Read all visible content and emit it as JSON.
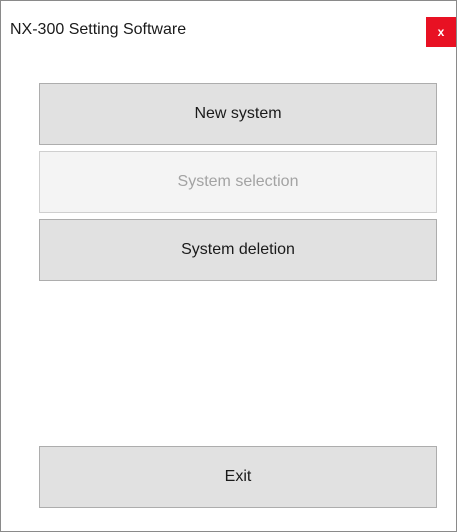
{
  "window": {
    "title": "NX-300 Setting Software",
    "close_glyph": "x",
    "close_icon": "close-icon",
    "close_color": "#e81123"
  },
  "menu": {
    "new_system": {
      "label": "New system",
      "enabled": true
    },
    "system_selection": {
      "label": "System selection",
      "enabled": false
    },
    "system_deletion": {
      "label": "System deletion",
      "enabled": true
    },
    "exit": {
      "label": "Exit",
      "enabled": true
    }
  }
}
